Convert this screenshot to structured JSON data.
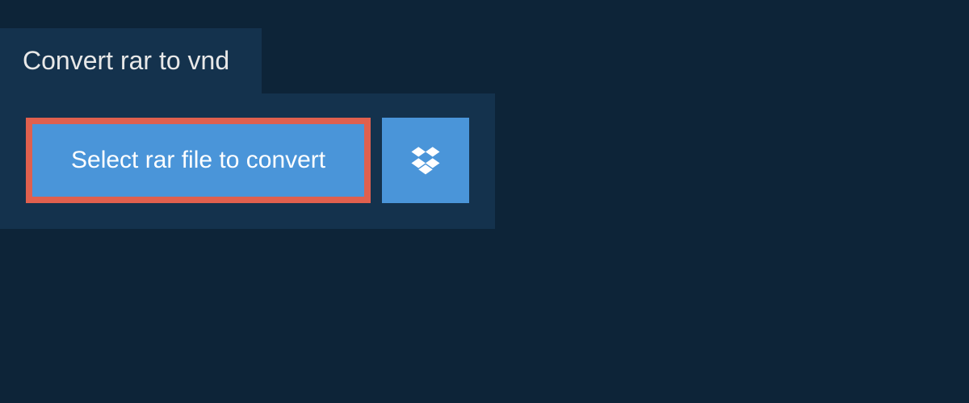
{
  "header": {
    "title": "Convert rar to vnd"
  },
  "actions": {
    "select_label": "Select rar file to convert"
  }
}
